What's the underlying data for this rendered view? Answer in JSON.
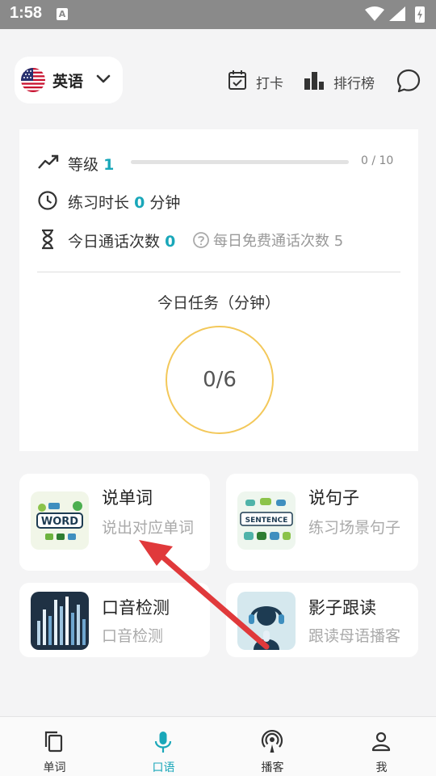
{
  "status_bar": {
    "time": "1:58",
    "app_icon_letter": "A"
  },
  "header": {
    "language": "英语",
    "checkin_label": "打卡",
    "leaderboard_label": "排行榜"
  },
  "stats": {
    "level_label": "等级",
    "level_value": "1",
    "level_progress": "0 / 10",
    "level_progress_fraction": 0,
    "practice_label": "练习时长",
    "practice_value": "0",
    "practice_unit": "分钟",
    "calls_label": "今日通话次数",
    "calls_value": "0",
    "free_calls_note": "每日免费通话次数 5"
  },
  "task": {
    "title": "今日任务（分钟）",
    "value": "0/6"
  },
  "features": [
    {
      "title": "说单词",
      "desc": "说出对应单词",
      "thumb_text": "WORD"
    },
    {
      "title": "说句子",
      "desc": "练习场景句子",
      "thumb_text": "SENTENCE"
    },
    {
      "title": "口音检测",
      "desc": "口音检测"
    },
    {
      "title": "影子跟读",
      "desc": "跟读母语播客"
    }
  ],
  "nav": [
    {
      "label": "单词",
      "icon": "copy-icon"
    },
    {
      "label": "口语",
      "icon": "microphone-icon",
      "active": true
    },
    {
      "label": "播客",
      "icon": "podcast-icon"
    },
    {
      "label": "我",
      "icon": "person-icon"
    }
  ],
  "colors": {
    "accent": "#19a7b9",
    "task_ring": "#f3c85a",
    "arrow": "#e0393b"
  }
}
